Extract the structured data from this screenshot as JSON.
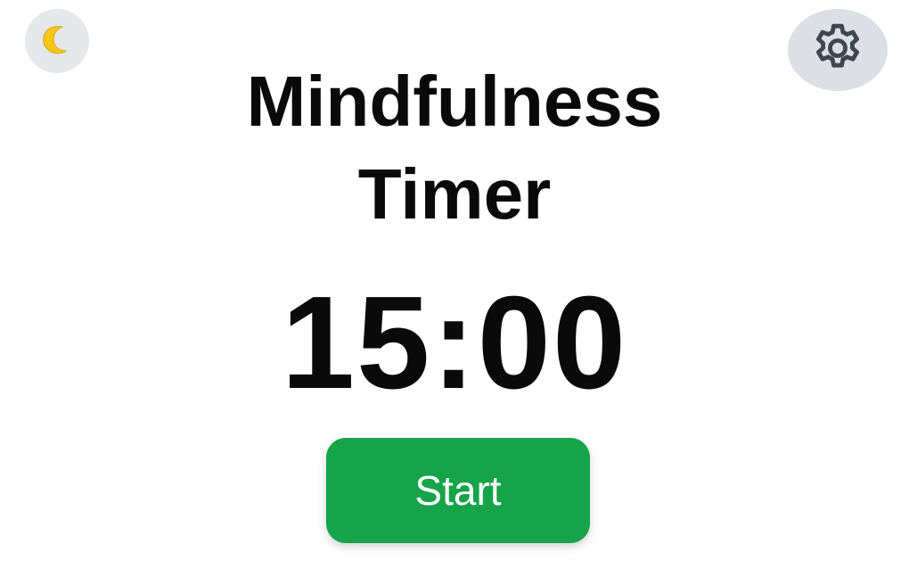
{
  "app": {
    "title_line1": "Mindfulness",
    "title_line2": "Timer",
    "timer_display": "15:00",
    "start_label": "Start"
  },
  "icons": {
    "theme_toggle": "moon-icon",
    "settings": "gear-icon"
  },
  "colors": {
    "accent_green": "#16a34a",
    "moon_yellow": "#f5c518",
    "icon_gray": "#3f4650",
    "button_bg": "#e5e7eb",
    "text": "#0a0a0a"
  }
}
